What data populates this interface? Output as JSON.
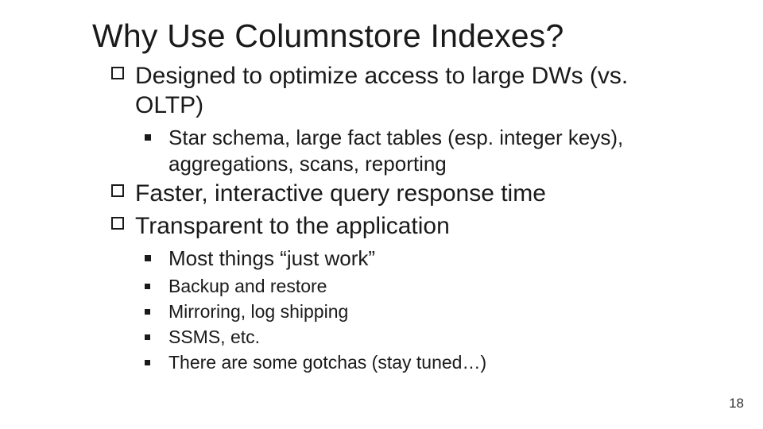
{
  "slide": {
    "title": "Why Use Columnstore Indexes?",
    "bullets": {
      "b1": "Designed to optimize access to large DWs (vs. OLTP)",
      "b1_s1": "Star schema, large fact tables (esp. integer keys), aggregations, scans, reporting",
      "b2": "Faster, interactive query response time",
      "b3": "Transparent to the application",
      "b3_s1": "Most things “just work”",
      "b3_s2": "Backup and restore",
      "b3_s3": "Mirroring, log shipping",
      "b3_s4": "SSMS, etc.",
      "b3_s5": "There are some gotchas (stay tuned…)"
    },
    "page_number": "18"
  }
}
